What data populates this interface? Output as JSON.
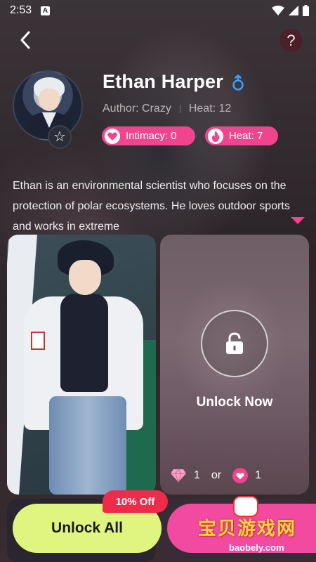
{
  "status_bar": {
    "time": "2:53",
    "app_letter": "A"
  },
  "header": {
    "help_label": "?"
  },
  "profile": {
    "name": "Ethan Harper",
    "author": "Author: Crazy",
    "heat": "Heat: 12",
    "intimacy_pill": "Intimacy: 0",
    "heat_pill": "Heat: 7"
  },
  "description": "Ethan is an environmental scientist who focuses on the protection of polar ecosystems. He loves outdoor sports and works in extreme",
  "locked_card": {
    "label": "Unlock Now",
    "gem_cost": "1",
    "or_label": "or",
    "heart_cost": "1"
  },
  "actions": {
    "unlock_all_label": "Unlock All",
    "discount_label": "10% Off"
  },
  "watermark": {
    "title": "宝贝游戏网",
    "url": "baobely.com"
  },
  "colors": {
    "accent_pink": "#f0458e",
    "unlock_all_bg": "#dff580",
    "discount_red": "#ef2b4a"
  }
}
